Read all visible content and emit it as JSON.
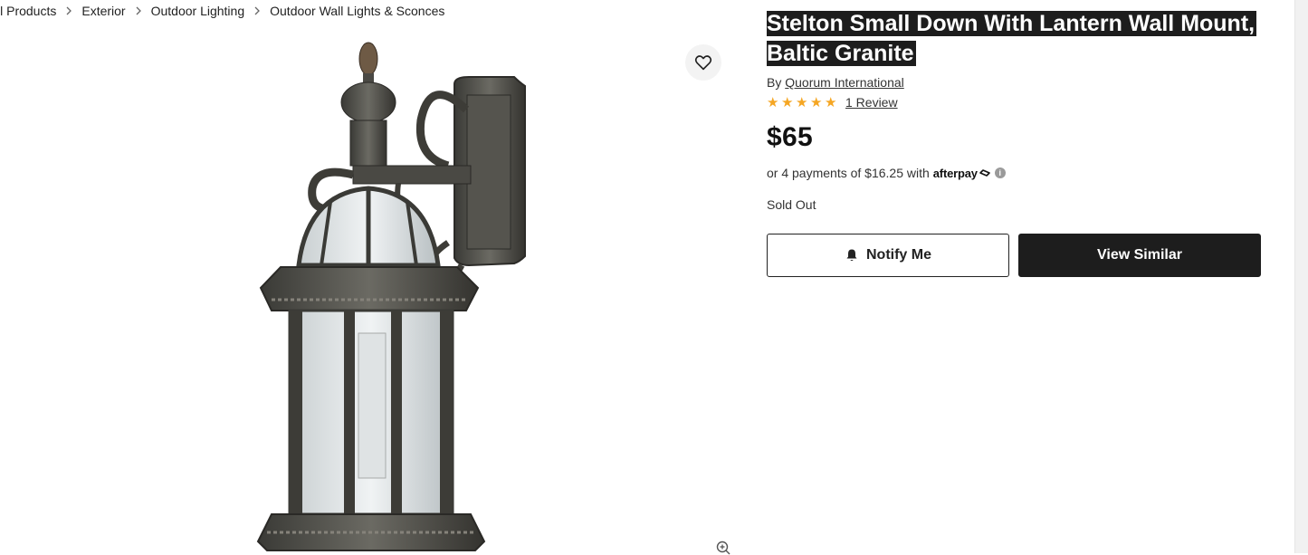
{
  "breadcrumb": {
    "items": [
      "ll Products",
      "Exterior",
      "Outdoor Lighting",
      "Outdoor Wall Lights & Sconces"
    ],
    "separator_icon": "chevron-right-icon"
  },
  "gallery": {
    "favorite_icon": "heart-icon",
    "zoom_icon": "zoom-in-icon"
  },
  "product": {
    "title": "Stelton Small Down With Lantern Wall Mount, Baltic Granite",
    "brand_prefix": "By",
    "brand": "Quorum International",
    "rating": 5,
    "rating_max": 5,
    "review_text": "1 Review",
    "price": "$65",
    "installments_text": "or 4 payments of $16.25 with",
    "afterpay_label": "afterpay",
    "stock_status": "Sold Out"
  },
  "actions": {
    "notify_label": "Notify Me",
    "notify_icon": "bell-icon",
    "view_similar_label": "View Similar"
  },
  "colors": {
    "star": "#f5a623",
    "dark_button": "#1d1d1d",
    "title_highlight": "#1d1d1d"
  }
}
